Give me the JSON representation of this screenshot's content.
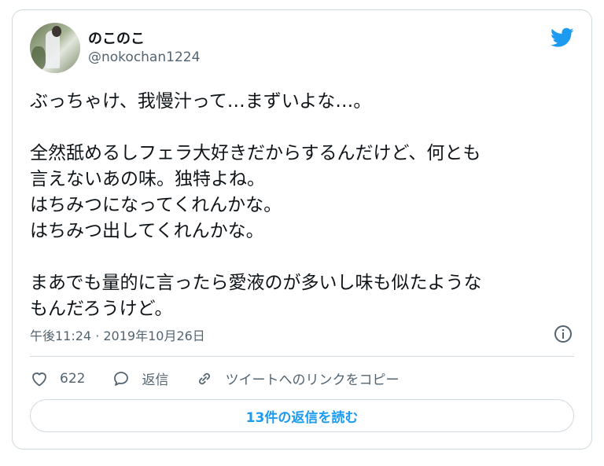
{
  "author": {
    "name": "のこのこ",
    "handle": "@nokochan1224"
  },
  "tweet": {
    "text": "ぶっちゃけ、我慢汁って…まずいよな…。\n\n全然舐めるしフェラ大好きだからするんだけど、何とも\n言えないあの味。独特よね。\nはちみつになってくれんかな。\nはちみつ出してくれんかな。\n\nまあでも量的に言ったら愛液のが多いし味も似たような\nもんだろうけど。",
    "timestamp": "午後11:24 · 2019年10月26日"
  },
  "actions": {
    "likes": "622",
    "reply_label": "返信",
    "copy_link_label": "ツイートへのリンクをコピー"
  },
  "read_replies_label": "13件の返信を読む",
  "colors": {
    "brand": "#1d9bf0",
    "secondary_text": "#536471",
    "border": "#cfd9de"
  },
  "icons": [
    "twitter-bird-icon",
    "info-icon",
    "heart-icon",
    "reply-bubble-icon",
    "link-icon"
  ]
}
